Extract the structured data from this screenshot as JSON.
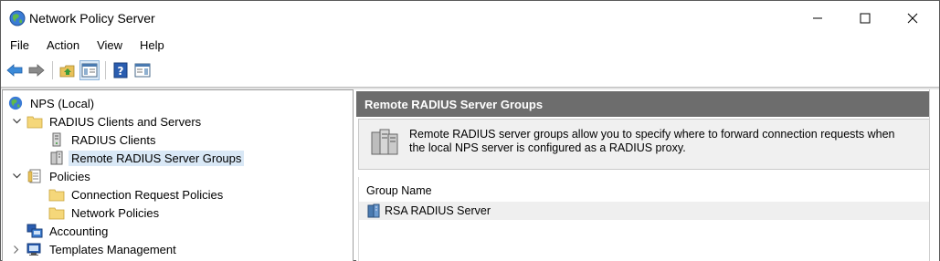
{
  "window": {
    "title": "Network Policy Server",
    "app_icon": "nps-globe-icon",
    "controls": [
      "minimize-icon",
      "maximize-icon",
      "close-icon"
    ]
  },
  "menu": {
    "items": [
      "File",
      "Action",
      "View",
      "Help"
    ]
  },
  "toolbar": {
    "buttons": [
      "back-arrow-icon",
      "forward-arrow-icon",
      "up-folder-icon",
      "show-hide-console-tree-icon",
      "help-icon",
      "show-hide-action-pane-icon"
    ]
  },
  "tree": {
    "items": [
      {
        "label": "NPS (Local)",
        "icon": "nps-globe-icon",
        "expander": "none",
        "level": 0
      },
      {
        "label": "RADIUS Clients and Servers",
        "icon": "folder-icon",
        "expander": "expanded",
        "level": 1
      },
      {
        "label": "RADIUS Clients",
        "icon": "server-icon",
        "expander": "none",
        "level": 2
      },
      {
        "label": "Remote RADIUS Server Groups",
        "icon": "server-group-icon",
        "expander": "none",
        "level": 2,
        "selected": true
      },
      {
        "label": "Policies",
        "icon": "policy-document-icon",
        "expander": "expanded",
        "level": 1
      },
      {
        "label": "Connection Request Policies",
        "icon": "folder-icon",
        "expander": "none",
        "level": 2
      },
      {
        "label": "Network Policies",
        "icon": "folder-icon",
        "expander": "none",
        "level": 2
      },
      {
        "label": "Accounting",
        "icon": "accounting-computer-icon",
        "expander": "none",
        "level": 1
      },
      {
        "label": "Templates Management",
        "icon": "templates-computer-icon",
        "expander": "collapsed",
        "level": 1
      }
    ]
  },
  "main": {
    "header": "Remote RADIUS Server Groups",
    "description": "Remote RADIUS server groups allow you to specify where to forward connection requests when the local NPS server is configured as a RADIUS proxy.",
    "description_icon": "server-stack-icon",
    "list": {
      "columns": [
        "Group Name"
      ],
      "rows": [
        {
          "name": "RSA RADIUS Server",
          "icon": "server-group-icon"
        }
      ]
    }
  },
  "colors": {
    "header_bg": "#6d6d6d",
    "selection_bg": "#d9e8f6",
    "description_bg": "#f0f0f0"
  }
}
